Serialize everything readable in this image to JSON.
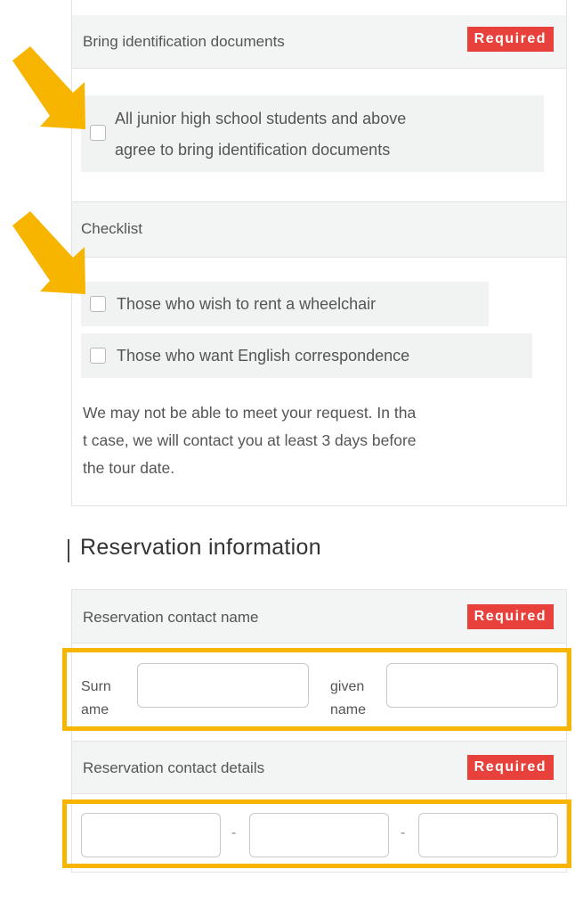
{
  "id_docs": {
    "label": "Bring identification documents",
    "badge": "Required",
    "option_line1": "All junior high school students and above",
    "option_line2": "agree to bring identification documents"
  },
  "checklist": {
    "label": "Checklist",
    "options": [
      "Those who wish to rent a wheelchair",
      "Those who want English correspondence"
    ],
    "note_lines": [
      "We may not be able to meet your request. In tha",
      "t case, we will contact you at least 3 days before",
      "the tour date."
    ]
  },
  "reservation": {
    "title": "Reservation information",
    "contact_name": {
      "label": "Reservation contact name",
      "badge": "Required",
      "surname_line1": "Surn",
      "surname_line2": "ame",
      "given_line1": "given",
      "given_line2": "name"
    },
    "contact_details": {
      "label": "Reservation contact details",
      "badge": "Required",
      "separator": "-"
    }
  },
  "colors": {
    "required_badge": "#e8413c",
    "highlight": "#f7b500",
    "section_bg": "#f3f4f4"
  }
}
